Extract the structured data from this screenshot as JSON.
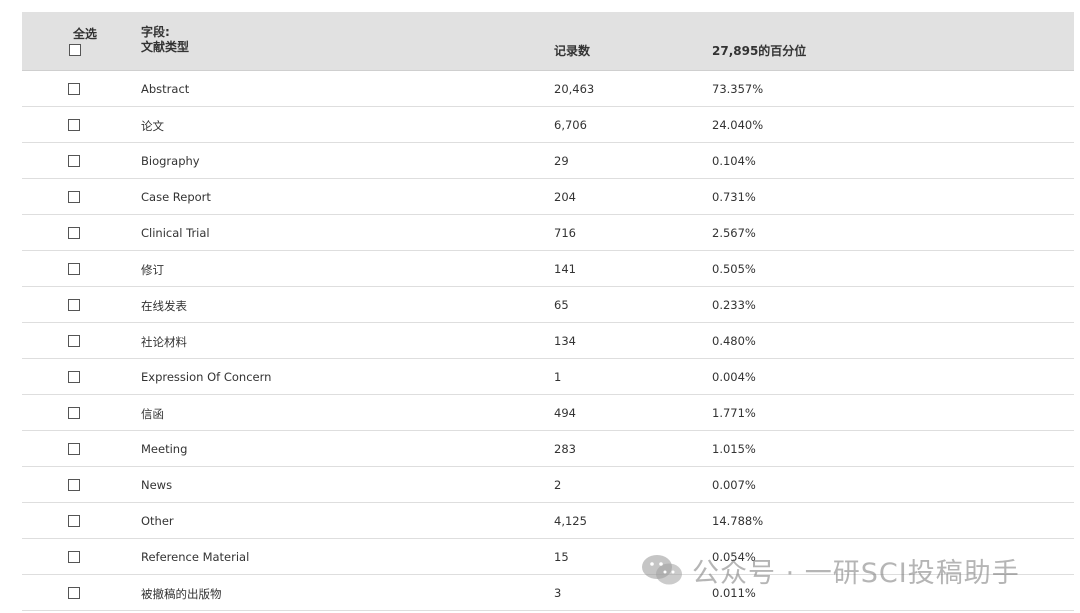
{
  "header": {
    "select_all": "全选",
    "field_line1": "字段:",
    "field_line2": "文献类型",
    "count_col": "记录数",
    "pct_col": "27,895的百分位"
  },
  "rows": [
    {
      "name": "Abstract",
      "count": "20,463",
      "pct": "73.357%"
    },
    {
      "name": "论文",
      "count": "6,706",
      "pct": "24.040%"
    },
    {
      "name": "Biography",
      "count": "29",
      "pct": "0.104%"
    },
    {
      "name": "Case Report",
      "count": "204",
      "pct": "0.731%"
    },
    {
      "name": "Clinical Trial",
      "count": "716",
      "pct": "2.567%"
    },
    {
      "name": "修订",
      "count": "141",
      "pct": "0.505%"
    },
    {
      "name": "在线发表",
      "count": "65",
      "pct": "0.233%"
    },
    {
      "name": "社论材料",
      "count": "134",
      "pct": "0.480%"
    },
    {
      "name": "Expression Of Concern",
      "count": "1",
      "pct": "0.004%"
    },
    {
      "name": "信函",
      "count": "494",
      "pct": "1.771%"
    },
    {
      "name": "Meeting",
      "count": "283",
      "pct": "1.015%"
    },
    {
      "name": "News",
      "count": "2",
      "pct": "0.007%"
    },
    {
      "name": "Other",
      "count": "4,125",
      "pct": "14.788%"
    },
    {
      "name": "Reference Material",
      "count": "15",
      "pct": "0.054%"
    },
    {
      "name": "被撤稿的出版物",
      "count": "3",
      "pct": "0.011%"
    }
  ],
  "watermark": {
    "text": "公众号 · 一研SCI投稿助手",
    "icon": "wechat-icon"
  }
}
